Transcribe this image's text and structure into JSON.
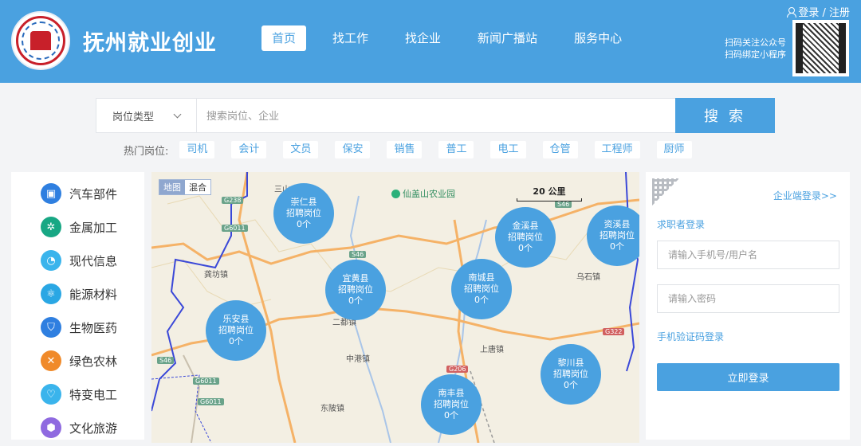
{
  "header": {
    "site_title": "抚州就业创业",
    "nav": [
      "首页",
      "找工作",
      "找企业",
      "新闻广播站",
      "服务中心"
    ],
    "login_register": "登录 / 注册",
    "qr_line1": "扫码关注公众号",
    "qr_line2": "扫码绑定小程序"
  },
  "search": {
    "job_type": "岗位类型",
    "placeholder": "搜索岗位、企业",
    "button": "搜 索"
  },
  "hot": {
    "label": "热门岗位:",
    "tags": [
      "司机",
      "会计",
      "文员",
      "保安",
      "销售",
      "普工",
      "电工",
      "仓管",
      "工程师",
      "厨师"
    ]
  },
  "categories": [
    {
      "label": "汽车部件",
      "icon": "car-parts-icon",
      "color": "#2f7fe0"
    },
    {
      "label": "金属加工",
      "icon": "metal-processing-icon",
      "color": "#18a784"
    },
    {
      "label": "现代信息",
      "icon": "modern-info-icon",
      "color": "#3ab4ec"
    },
    {
      "label": "能源材料",
      "icon": "energy-materials-icon",
      "color": "#2aa7e4"
    },
    {
      "label": "生物医药",
      "icon": "biomedicine-icon",
      "color": "#2f7fe0"
    },
    {
      "label": "绿色农林",
      "icon": "green-agriculture-icon",
      "color": "#f08a2a"
    },
    {
      "label": "特变电工",
      "icon": "electrical-icon",
      "color": "#3ab4ec"
    },
    {
      "label": "文化旅游",
      "icon": "culture-tourism-icon",
      "color": "#8f6ae0"
    }
  ],
  "map": {
    "toggle_map": "地图",
    "toggle_mixed": "混合",
    "scale": "20 公里",
    "poi": "仙盖山农业园",
    "bubbles": [
      {
        "name": "崇仁县",
        "label": "招聘岗位",
        "count": "0个"
      },
      {
        "name": "宜黄县",
        "label": "招聘岗位",
        "count": "0个"
      },
      {
        "name": "乐安县",
        "label": "招聘岗位",
        "count": "0个"
      },
      {
        "name": "南城县",
        "label": "招聘岗位",
        "count": "0个"
      },
      {
        "name": "金溪县",
        "label": "招聘岗位",
        "count": "0个"
      },
      {
        "name": "资溪县",
        "label": "招聘岗位",
        "count": "0个"
      },
      {
        "name": "黎川县",
        "label": "招聘岗位",
        "count": "0个"
      },
      {
        "name": "南丰县",
        "label": "招聘岗位",
        "count": "0个"
      }
    ],
    "places": [
      "龚坊镇",
      "二都镇",
      "中港镇",
      "东陂镇",
      "上唐镇",
      "乌石镇",
      "三山"
    ],
    "roads": [
      "G238",
      "G6011",
      "S46",
      "S46",
      "G6011",
      "G6011",
      "S46",
      "G322",
      "G206"
    ]
  },
  "login": {
    "enterprise_link": "企业端登录>>",
    "seeker_tab": "求职者登录",
    "phone_placeholder": "请输入手机号/用户名",
    "password_placeholder": "请输入密码",
    "sms_link": "手机验证码登录",
    "login_button": "立即登录"
  }
}
